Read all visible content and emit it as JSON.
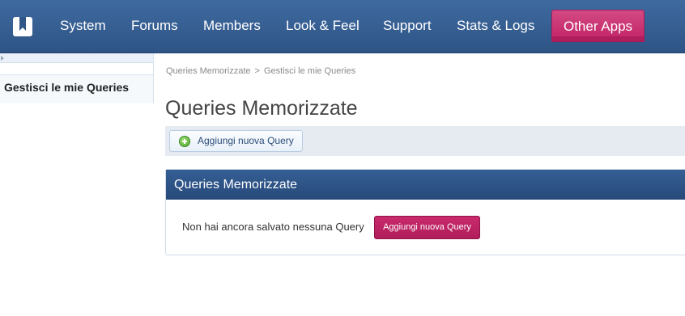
{
  "nav": {
    "items": [
      "System",
      "Forums",
      "Members",
      "Look & Feel",
      "Support",
      "Stats & Logs"
    ],
    "other_apps": "Other Apps",
    "logo_icon": "book-icon"
  },
  "sidebar": {
    "arrow_icon": "triangle-right-icon",
    "link": "Gestisci le mie Queries"
  },
  "breadcrumb": {
    "root": "Queries Memorizzate",
    "separator": ">",
    "current": "Gestisci le mie Queries"
  },
  "page": {
    "title": "Queries Memorizzate",
    "add_button": "Aggiungi nuova Query",
    "add_icon": "plus-circle-icon"
  },
  "panel": {
    "title": "Queries Memorizzate",
    "empty_message": "Non hai ancora salvato nessuna Query",
    "add_button": "Aggiungi nuova Query"
  },
  "colors": {
    "nav_bg": "#2e5485",
    "accent_pink": "#c22266",
    "panel_header": "#2d5286"
  }
}
